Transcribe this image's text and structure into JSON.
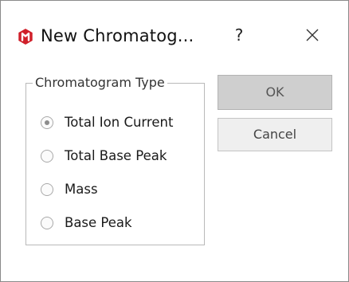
{
  "window": {
    "title": "New Chromatog...",
    "help_label": "?",
    "close_label": "close",
    "icon_color": "#d0202a"
  },
  "chromatogram_type": {
    "legend": "Chromatogram Type",
    "options": [
      {
        "label": "Total Ion Current",
        "selected": true
      },
      {
        "label": "Total Base Peak",
        "selected": false
      },
      {
        "label": "Mass",
        "selected": false
      },
      {
        "label": "Base Peak",
        "selected": false
      }
    ]
  },
  "buttons": {
    "ok_label": "OK",
    "cancel_label": "Cancel"
  }
}
